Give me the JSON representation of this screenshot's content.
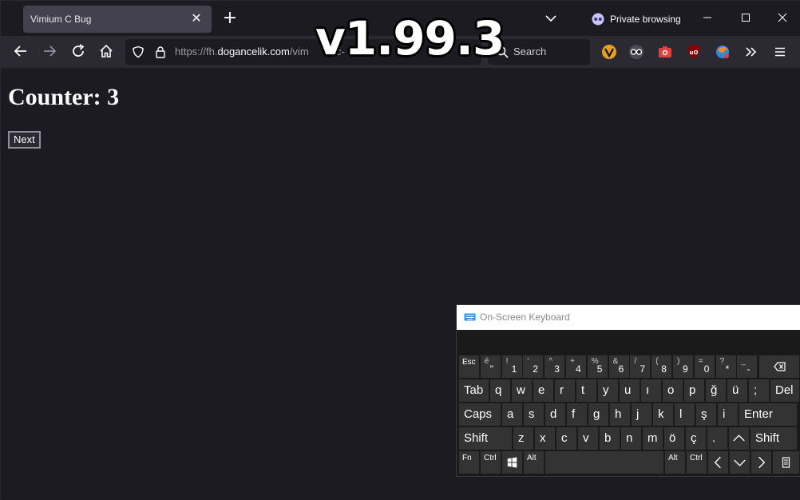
{
  "browser": {
    "tab_title": "Vimium C Bug",
    "private_label": "Private browsing",
    "url_prefix": "https://fh.",
    "url_domain": "dogancelik.com",
    "url_path": "/vim",
    "url_trailing": "-c-",
    "search_placeholder": "Search"
  },
  "overlay": {
    "version": "v1.99.3"
  },
  "page": {
    "counter_text": "Counter: 3",
    "next_label": "Next"
  },
  "osk": {
    "title": "On-Screen Keyboard",
    "row1": [
      {
        "label": "Esc",
        "small": true
      },
      {
        "top": "é",
        "bot": "\""
      },
      {
        "top": "!",
        "bot": "1"
      },
      {
        "top": "'",
        "bot": "2"
      },
      {
        "top": "^",
        "bot": "3"
      },
      {
        "top": "+",
        "bot": "4"
      },
      {
        "top": "%",
        "bot": "5"
      },
      {
        "top": "&",
        "bot": "6"
      },
      {
        "top": "/",
        "bot": "7"
      },
      {
        "top": "(",
        "bot": "8"
      },
      {
        "top": ")",
        "bot": "9"
      },
      {
        "top": "=",
        "bot": "0"
      },
      {
        "top": "?",
        "bot": "*"
      },
      {
        "top": "_",
        "bot": "-"
      }
    ],
    "row2": [
      "Tab",
      "q",
      "w",
      "e",
      "r",
      "t",
      "y",
      "u",
      "ı",
      "o",
      "p",
      "ğ",
      "ü",
      ";",
      "Del"
    ],
    "row3": [
      "Caps",
      "a",
      "s",
      "d",
      "f",
      "g",
      "h",
      "j",
      "k",
      "l",
      "ş",
      "i",
      "Enter"
    ],
    "row4": [
      "Shift",
      "z",
      "x",
      "c",
      "v",
      "b",
      "n",
      "m",
      "ö",
      "ç",
      ".",
      "Shift"
    ],
    "row5": [
      "Fn",
      "Ctrl",
      "Alt",
      "Alt",
      "Ctrl"
    ],
    "colors": {
      "key": "#333333",
      "bg": "#1a1a1a",
      "title_bg": "#ffffff"
    }
  }
}
